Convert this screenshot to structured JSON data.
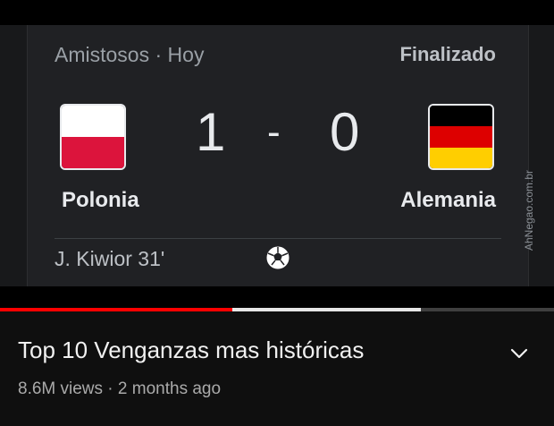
{
  "match": {
    "competition": "Amistosos",
    "separator": " · ",
    "day": "Hoy",
    "status": "Finalizado",
    "home": {
      "name": "Polonia",
      "score": "1",
      "flag": "poland-flag-icon"
    },
    "away": {
      "name": "Alemania",
      "score": "0",
      "flag": "germany-flag-icon"
    },
    "score_separator": "-",
    "scorer": "J. Kiwior 31'",
    "goal_icon": "soccer-ball-icon"
  },
  "watermark": "AhNegao.com.br",
  "player": {
    "played_fraction": 0.42,
    "buffered_fraction": 0.76,
    "colors": {
      "played": "#ff0000",
      "buffered": "#e6e6e6"
    }
  },
  "video": {
    "title": "Top 10 Venganzas mas históricas",
    "views": "8.6M views",
    "dot": " · ",
    "age": "2 months ago",
    "expand_icon": "chevron-down-icon"
  }
}
